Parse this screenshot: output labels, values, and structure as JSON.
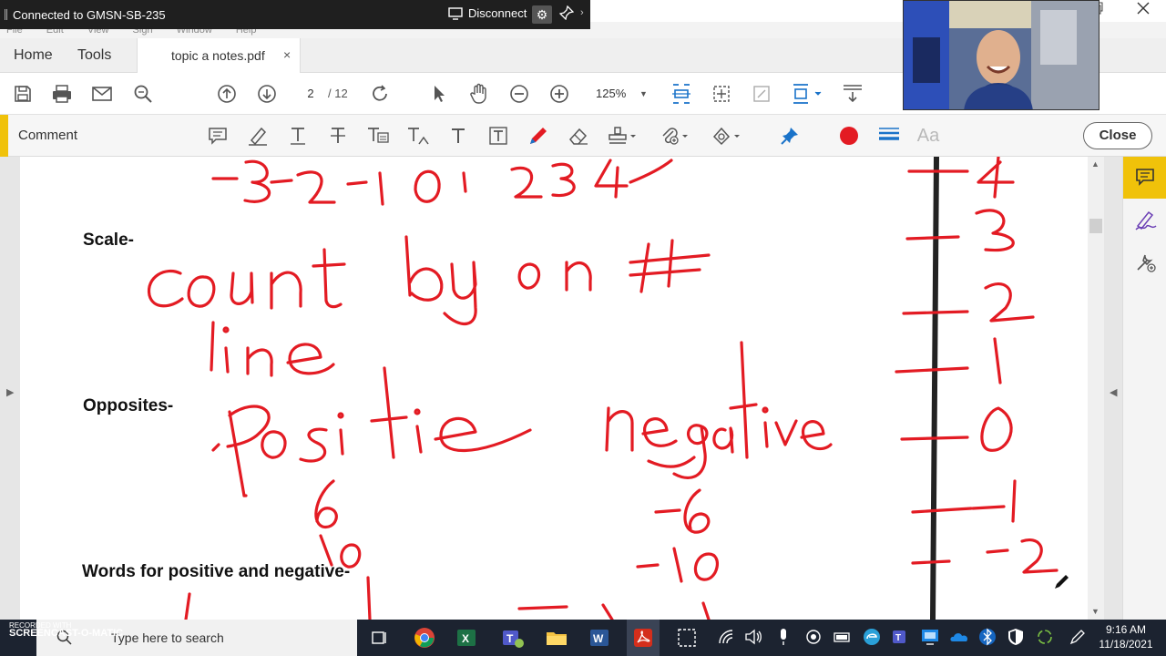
{
  "remote_bar": {
    "title": "Connected to GMSN-SB-235",
    "disconnect": "Disconnect"
  },
  "menu": [
    "File",
    "Edit",
    "View",
    "Sign",
    "Window",
    "Help"
  ],
  "tabs": {
    "home": "Home",
    "tools": "Tools",
    "document": "topic a notes.pdf",
    "close": "×"
  },
  "toolbar": {
    "page_current": "2",
    "page_total": "/ 12",
    "zoom": "125%"
  },
  "comment_bar": {
    "label": "Comment",
    "font_button": "Aa",
    "close_button": "Close",
    "ink_color": "#e31b23"
  },
  "document": {
    "labels": {
      "scale": "Scale-",
      "opposites": "Opposites-",
      "words": "Words for positive and negative-"
    },
    "handwriting": {
      "number_line_top": "-3 -2 -1 0 1 2 3 4",
      "scale_note_1": "count by on #",
      "scale_note_2": "line",
      "positive": "positive",
      "negative": "negative",
      "pos_a": "6",
      "pos_b": "10",
      "neg_a": "-6",
      "neg_b": "-10",
      "vertical_line_numbers": [
        "4",
        "3",
        "2",
        "1",
        "0",
        "-1",
        "-2"
      ]
    }
  },
  "taskbar": {
    "search": "Type here to search",
    "time": "9:16 AM",
    "date": "11/18/2021",
    "watermark_top": "RECORDED WITH",
    "watermark_brand": "SCREENCAST-O-MATIC"
  }
}
